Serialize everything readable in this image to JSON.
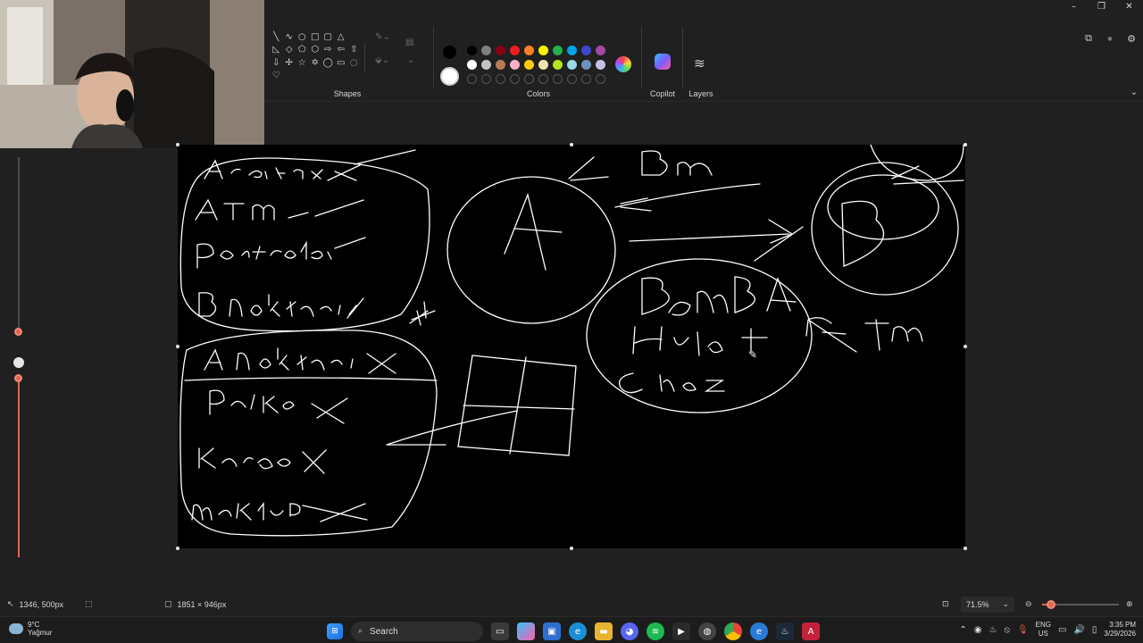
{
  "window": {
    "controls": {
      "minimize": "–",
      "restore": "❐",
      "close": "✕"
    },
    "right_icons": {
      "share": "⧉",
      "notifications": "●",
      "settings": "⚙"
    }
  },
  "ribbon": {
    "shapes_label": "Shapes",
    "colors_label": "Colors",
    "copilot_label": "Copilot",
    "layers_label": "Layers",
    "shapes": [
      "╲",
      "∿",
      "○",
      "□",
      "▢",
      "△",
      "",
      "◺",
      "◇",
      "⬠",
      "⬡",
      "⇨",
      "⇦",
      "⇧",
      "⇩",
      "✢",
      "☆",
      "✡",
      "◯",
      "▭",
      "◌",
      "♡",
      "",
      "",
      "",
      "",
      "",
      ""
    ],
    "colors_row1": [
      "#000000",
      "#7f7f7f",
      "#880015",
      "#ed1c24",
      "#ff7f27",
      "#fff200",
      "#22b14c",
      "#00a2e8",
      "#3f48cc",
      "#a349a4"
    ],
    "colors_row2": [
      "#ffffff",
      "#c3c3c3",
      "#b97a57",
      "#ffaec9",
      "#ffc90e",
      "#efe4b0",
      "#b5e61d",
      "#99d9ea",
      "#7092be",
      "#c8bfe7"
    ],
    "primary_color": "#000000",
    "secondary_color": "#ffffff"
  },
  "sliders": {
    "size_level": 0.0,
    "opacity_level": 1.0,
    "accent": "#e06650"
  },
  "canvas": {
    "background": "#000000",
    "stroke": "#ffffff"
  },
  "status": {
    "cursor_position": "1346, 500px",
    "selection_size": "",
    "canvas_size": "1851 × 946px",
    "zoom": "71.5%",
    "zoom_level": 0.12
  },
  "taskbar": {
    "weather_temp": "9°C",
    "weather_desc": "Yağmur",
    "search_placeholder": "Search",
    "lang_top": "ENG",
    "lang_bottom": "US",
    "time": "3:35 PM",
    "date": "3/29/2026"
  }
}
